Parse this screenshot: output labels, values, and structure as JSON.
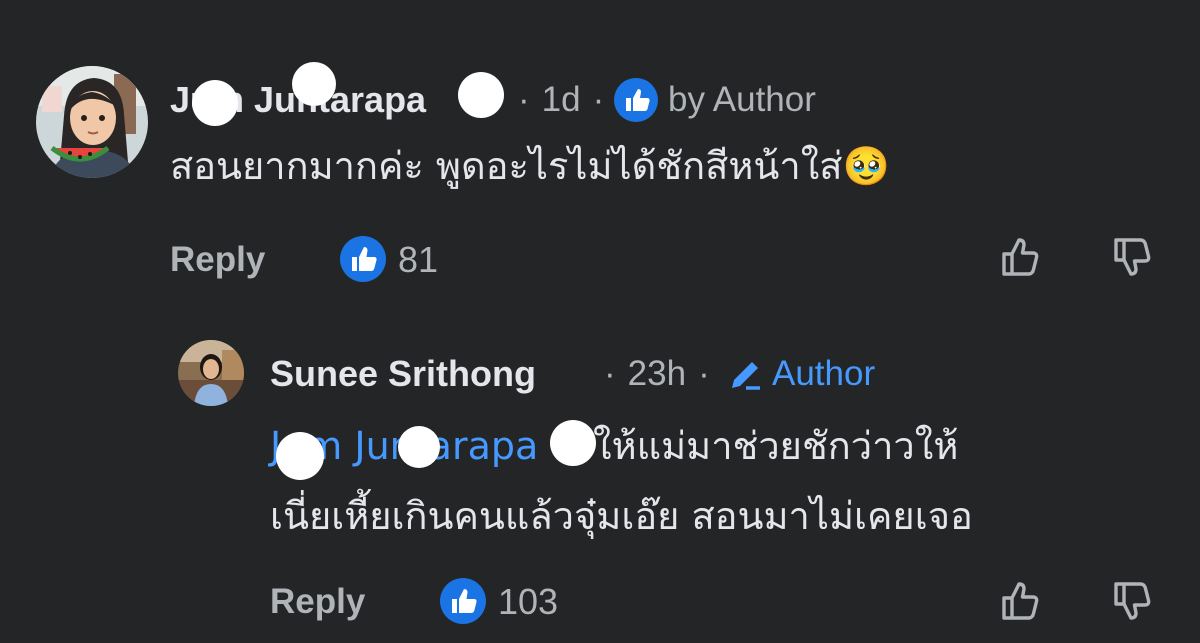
{
  "comment1": {
    "author_name": "Jum Juntarapa",
    "time": "1d",
    "dot": "·",
    "badge_label": "by Author",
    "text": "สอนยากมากค่ะ พูดอะไรไม่ได้ชักสีหน้าใส่",
    "emoji": "🥹",
    "reply_label": "Reply",
    "like_count": "81"
  },
  "reply1": {
    "author_name": "Sunee Srithong",
    "time": "23h",
    "dot": "·",
    "badge_label": "Author",
    "mention": "Jum Juntarapa",
    "text_line1": " จะให้แม่มาช่วยชักว่าวให้",
    "text_line2": "เนี่ยเหี้ยเกินคนแล้วจุ๋มเอ๊ย สอนมาไม่เคยเจอ",
    "reply_label": "Reply",
    "like_count": "103"
  },
  "colors": {
    "background": "#242526",
    "text_primary": "#e4e6eb",
    "text_secondary": "#b0b3b8",
    "accent_blue": "#4599ff",
    "like_badge": "#1b74e4"
  },
  "icons": {
    "like_badge": "thumbs-up-badge-icon",
    "upvote": "thumbs-up-outline-icon",
    "downvote": "thumbs-down-outline-icon",
    "author_badge": "author-thumbs-up-icon",
    "author_pencil": "pencil-icon"
  }
}
